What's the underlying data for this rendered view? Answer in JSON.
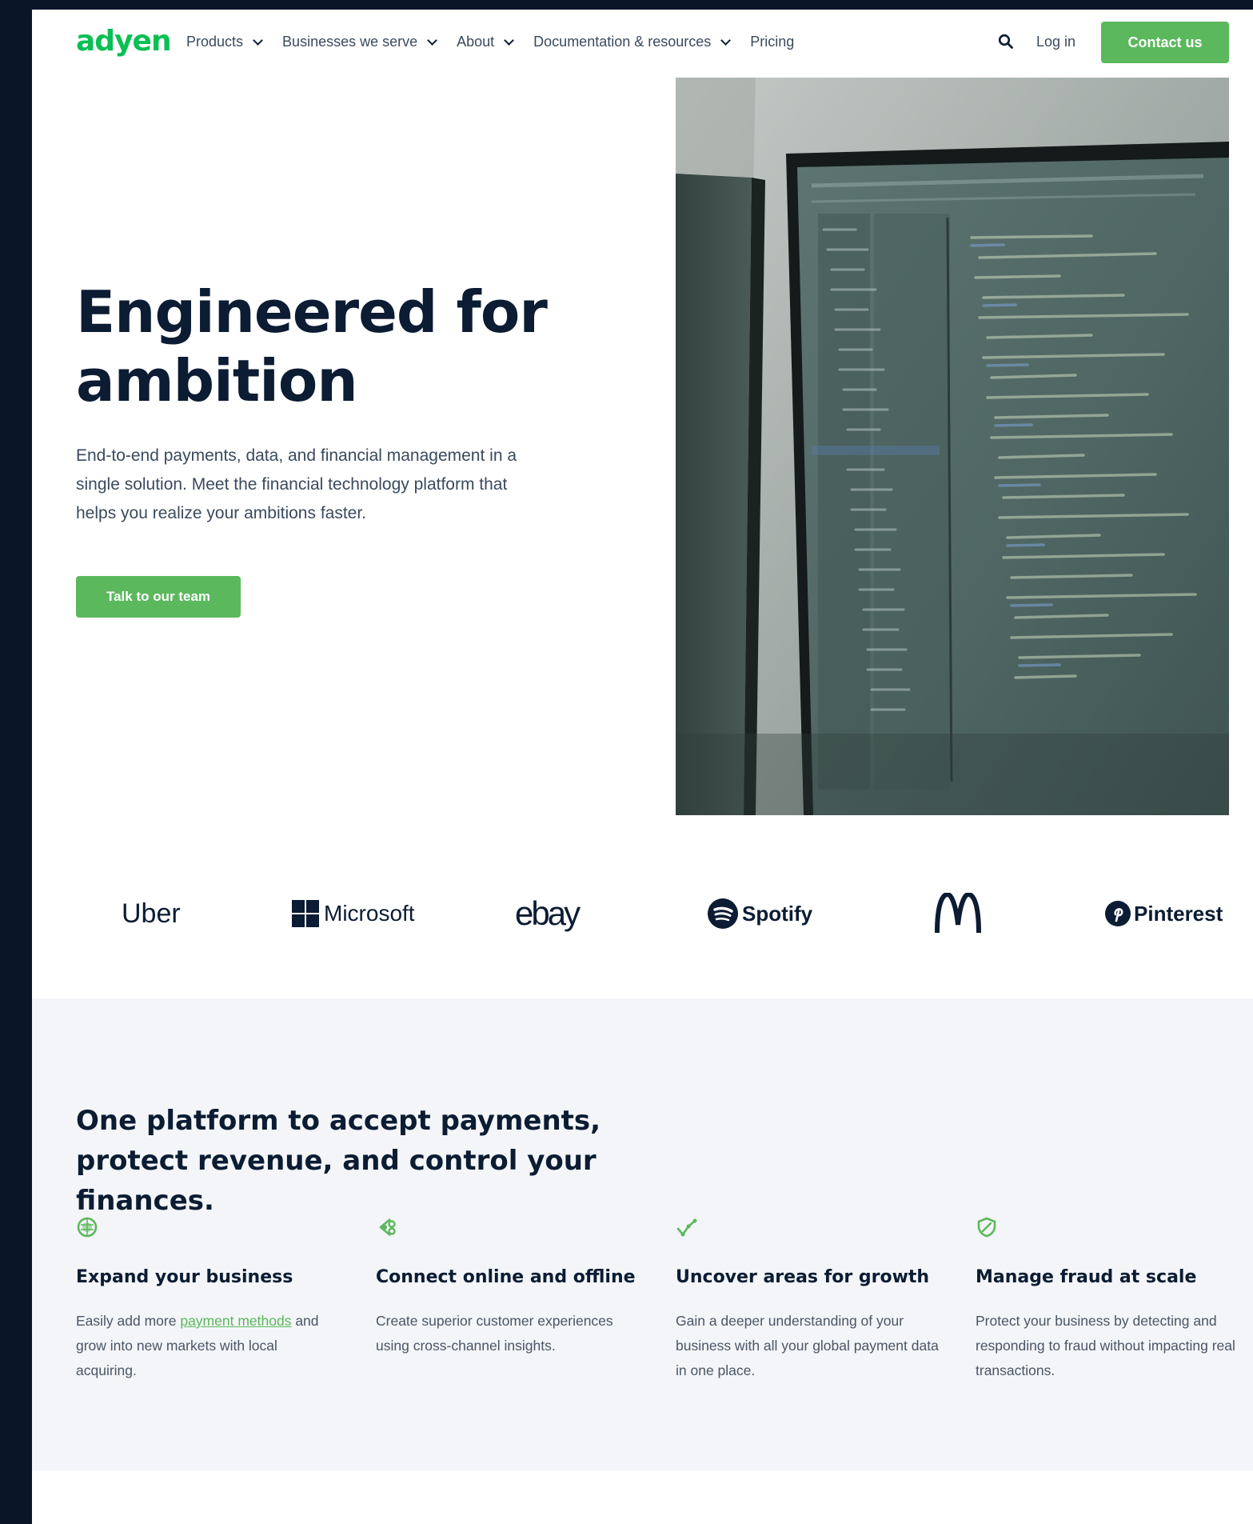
{
  "nav": {
    "logo": "adyen",
    "items": [
      {
        "label": "Products",
        "has_dropdown": true
      },
      {
        "label": "Businesses we serve",
        "has_dropdown": true
      },
      {
        "label": "About",
        "has_dropdown": true
      },
      {
        "label": "Documentation & resources",
        "has_dropdown": true
      },
      {
        "label": "Pricing",
        "has_dropdown": false
      }
    ],
    "search_icon": "search-icon",
    "login": "Log in",
    "contact": "Contact us"
  },
  "hero": {
    "title": "Engineered for ambition",
    "description": "End-to-end payments, data, and financial management in a single solution. Meet the financial technology platform that helps you realize your ambitions faster.",
    "cta": "Talk to our team"
  },
  "logos": [
    "Uber",
    "Microsoft",
    "ebay",
    "Spotify",
    "McDonald's",
    "Pinterest"
  ],
  "features": {
    "title": "One platform to accept payments, protect revenue, and control your finances.",
    "items": [
      {
        "icon": "globe-icon",
        "title": "Expand your business",
        "text_before": "Easily add more ",
        "link": "payment methods",
        "text_after": " and grow into new markets with local acquiring."
      },
      {
        "icon": "connect-icon",
        "title": "Connect online and offline",
        "text": "Create superior customer experiences using cross-channel insights."
      },
      {
        "icon": "growth-chart-icon",
        "title": "Uncover areas for growth",
        "text": "Gain a deeper understanding of your business with all your global payment data in one place."
      },
      {
        "icon": "shield-icon",
        "title": "Manage fraud at scale",
        "text": "Protect your business by detecting and responding to fraud without impacting real transactions."
      }
    ]
  },
  "colors": {
    "brand_green": "#0abf53",
    "button_green": "#5bb85c",
    "navy": "#0b1c33",
    "section_bg": "#f3f5f8",
    "frame_bg": "#0a1628"
  }
}
